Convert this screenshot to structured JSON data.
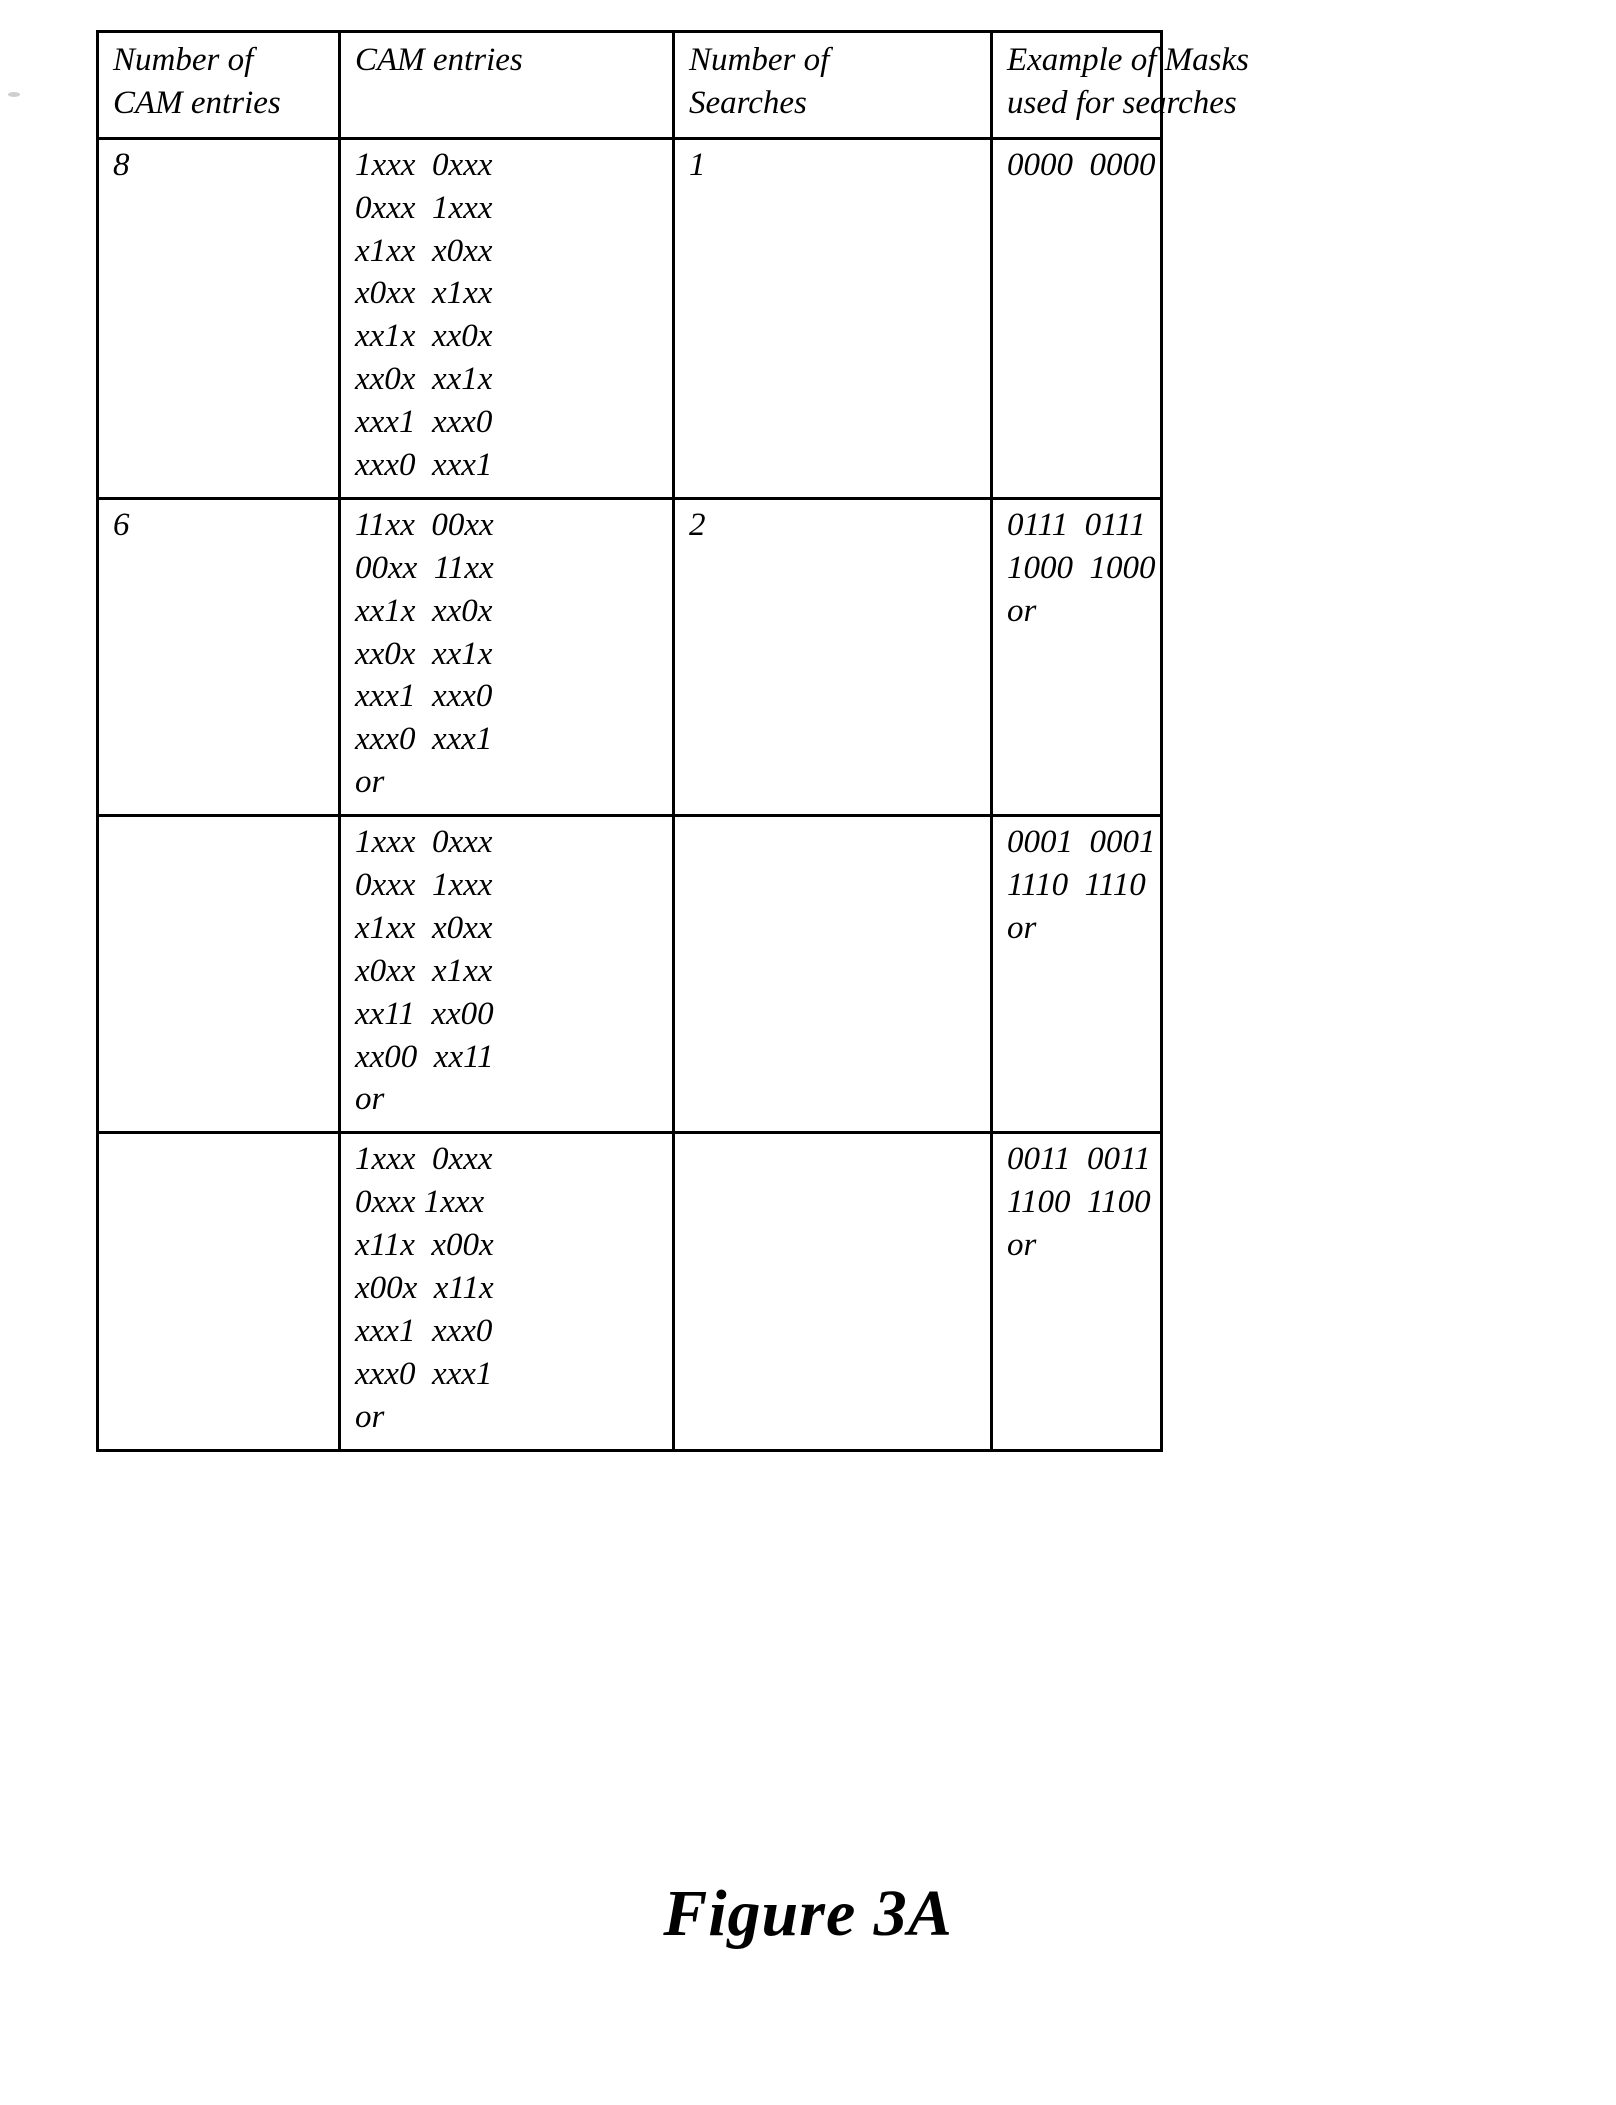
{
  "figure": {
    "caption": "Figure 3A"
  },
  "table": {
    "headers": [
      {
        "line1": "Number of",
        "line2": "CAM entries"
      },
      {
        "line1": "CAM entries",
        "line2": ""
      },
      {
        "line1": "Number of",
        "line2": "Searches"
      },
      {
        "line1": "Example of Masks",
        "line2": "used for searches"
      }
    ],
    "rows": [
      {
        "num_cam_entries": "8",
        "cam_entries": [
          "1xxx  0xxx",
          "0xxx  1xxx",
          "x1xx  x0xx",
          "x0xx  x1xx",
          "xx1x  xx0x",
          "xx0x  xx1x",
          "xxx1  xxx0",
          "xxx0  xxx1"
        ],
        "number_of_searches": "1",
        "masks": [
          "0000  0000"
        ]
      },
      {
        "num_cam_entries": "6",
        "cam_entries": [
          "11xx  00xx",
          "00xx  11xx",
          "xx1x  xx0x",
          "xx0x  xx1x",
          "xxx1  xxx0",
          "xxx0  xxx1",
          "or"
        ],
        "number_of_searches": "2",
        "masks": [
          "0111  0111",
          "1000  1000",
          "or"
        ]
      },
      {
        "num_cam_entries": "",
        "cam_entries": [
          "1xxx  0xxx",
          "0xxx  1xxx",
          "x1xx  x0xx",
          "x0xx  x1xx",
          "xx11  xx00",
          "xx00  xx11",
          "or"
        ],
        "number_of_searches": "",
        "masks": [
          "0001  0001",
          "1110  1110",
          "or"
        ]
      },
      {
        "num_cam_entries": "",
        "cam_entries": [
          "1xxx  0xxx",
          "0xxx 1xxx",
          "x11x  x00x",
          "x00x  x11x",
          "xxx1  xxx0",
          "xxx0  xxx1",
          "or"
        ],
        "number_of_searches": "",
        "masks": [
          "0011  0011",
          "1100  1100",
          "or"
        ]
      }
    ]
  }
}
